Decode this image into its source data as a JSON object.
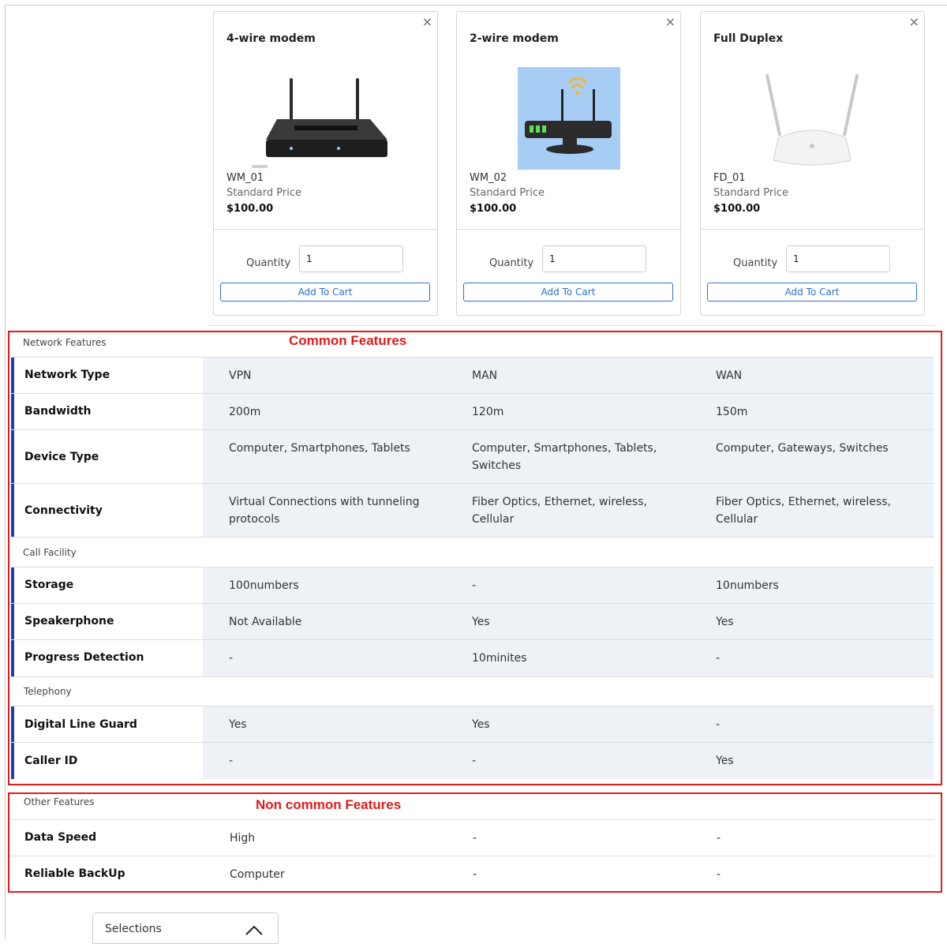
{
  "products": [
    {
      "title": "4-wire modem",
      "sku": "WM_01",
      "price_label": "Standard Price",
      "price": "$100.00",
      "quantity_label": "Quantity",
      "quantity": "1",
      "add_label": "Add To Cart",
      "close": "×",
      "image": "router-black-icon"
    },
    {
      "title": "2-wire modem",
      "sku": "WM_02",
      "price_label": "Standard Price",
      "price": "$100.00",
      "quantity_label": "Quantity",
      "quantity": "1",
      "add_label": "Add To Cart",
      "close": "×",
      "image": "wifi-router-icon"
    },
    {
      "title": "Full Duplex",
      "sku": "FD_01",
      "price_label": "Standard Price",
      "price": "$100.00",
      "quantity_label": "Quantity",
      "quantity": "1",
      "add_label": "Add To Cart",
      "close": "×",
      "image": "router-white-icon"
    }
  ],
  "annotations": {
    "common": "Common Features",
    "non_common": "Non common Features"
  },
  "common_sections": [
    {
      "label": "Network Features",
      "rows": [
        {
          "name": "Network Type",
          "values": [
            "VPN",
            "MAN",
            "WAN"
          ]
        },
        {
          "name": "Bandwidth",
          "values": [
            "200m",
            "120m",
            "150m"
          ]
        },
        {
          "name": "Device Type",
          "values": [
            "Computer, Smartphones, Tablets",
            "Computer, Smartphones, Tablets, Switches",
            "Computer, Gateways, Switches"
          ]
        },
        {
          "name": "Connectivity",
          "values": [
            "Virtual Connections with tunneling protocols",
            "Fiber Optics, Ethernet, wireless, Cellular",
            "Fiber Optics, Ethernet, wireless, Cellular"
          ]
        }
      ]
    },
    {
      "label": "Call Facility",
      "rows": [
        {
          "name": "Storage",
          "values": [
            "100numbers",
            "-",
            "10numbers"
          ]
        },
        {
          "name": "Speakerphone",
          "values": [
            "Not Available",
            "Yes",
            "Yes"
          ]
        },
        {
          "name": "Progress Detection",
          "values": [
            "-",
            "10minites",
            "-"
          ]
        }
      ]
    },
    {
      "label": "Telephony",
      "rows": [
        {
          "name": "Digital Line Guard",
          "values": [
            "Yes",
            "Yes",
            "-"
          ]
        },
        {
          "name": "Caller ID",
          "values": [
            "-",
            "-",
            "Yes"
          ]
        }
      ]
    }
  ],
  "other_section": {
    "label": "Other Features",
    "rows": [
      {
        "name": "Data Speed",
        "values": [
          "High",
          "-",
          "-"
        ]
      },
      {
        "name": "Reliable BackUp",
        "values": [
          "Computer",
          "-",
          "-"
        ]
      }
    ]
  },
  "selections": {
    "label": "Selections",
    "icon": "chevron-up-icon"
  },
  "colors": {
    "accent": "#1c3fa3",
    "link": "#2f6fcf",
    "annotation": "#e21b1b",
    "value_bg": "#eef2f6"
  }
}
